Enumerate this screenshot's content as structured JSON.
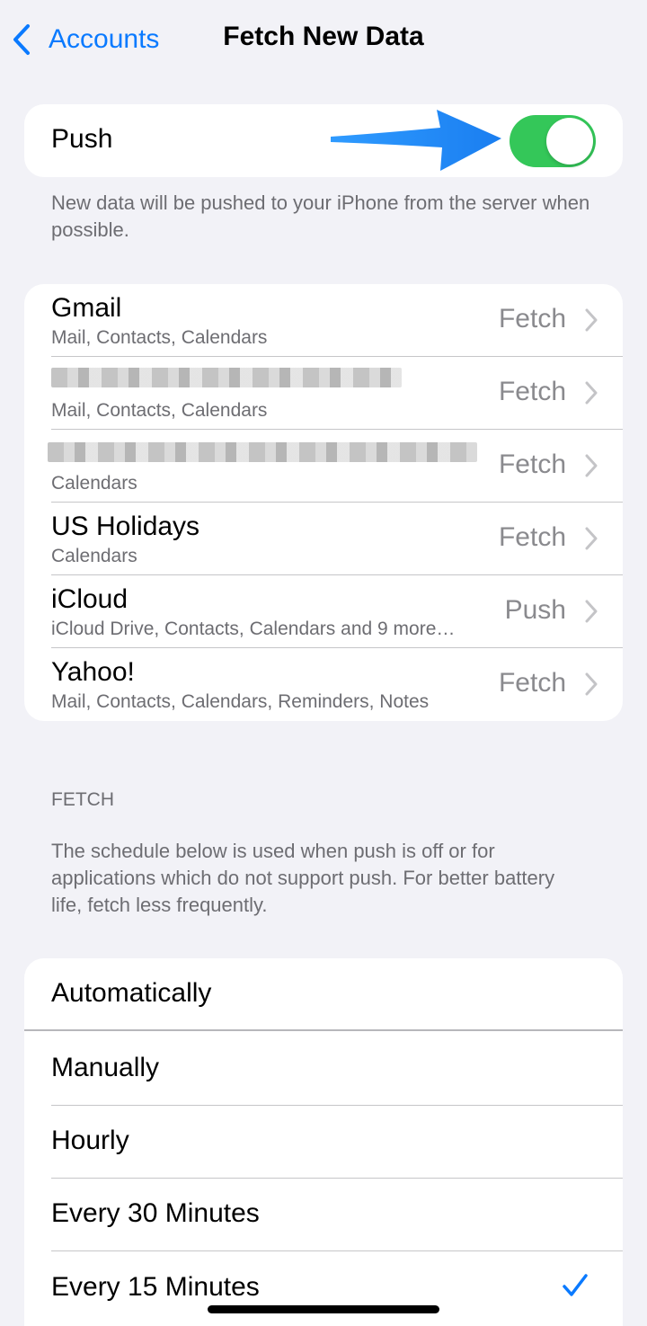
{
  "nav": {
    "back_label": "Accounts",
    "title": "Fetch New Data"
  },
  "push": {
    "label": "Push",
    "enabled": true,
    "footnote": "New data will be pushed to your iPhone from the server when possible."
  },
  "accounts": [
    {
      "name": "Gmail",
      "details": "Mail, Contacts, Calendars",
      "value": "Fetch",
      "redacted": false
    },
    {
      "name": "",
      "details": "Mail, Contacts, Calendars",
      "value": "Fetch",
      "redacted": true
    },
    {
      "name": "",
      "details": "Calendars",
      "value": "Fetch",
      "redacted": true
    },
    {
      "name": "US Holidays",
      "details": "Calendars",
      "value": "Fetch",
      "redacted": false
    },
    {
      "name": "iCloud",
      "details": "iCloud Drive, Contacts, Calendars and 9 more…",
      "value": "Push",
      "redacted": false
    },
    {
      "name": "Yahoo!",
      "details": "Mail, Contacts, Calendars, Reminders, Notes",
      "value": "Fetch",
      "redacted": false
    }
  ],
  "fetch": {
    "header": "FETCH",
    "footnote": "The schedule below is used when push is off or for applications which do not support push. For better battery life, fetch less frequently.",
    "options": [
      "Automatically",
      "Manually",
      "Hourly",
      "Every 30 Minutes",
      "Every 15 Minutes"
    ],
    "selected": "Every 15 Minutes"
  },
  "colors": {
    "accent": "#0a7aff",
    "toggle_on": "#34c759",
    "annotation_arrow": "#1a8cff"
  }
}
